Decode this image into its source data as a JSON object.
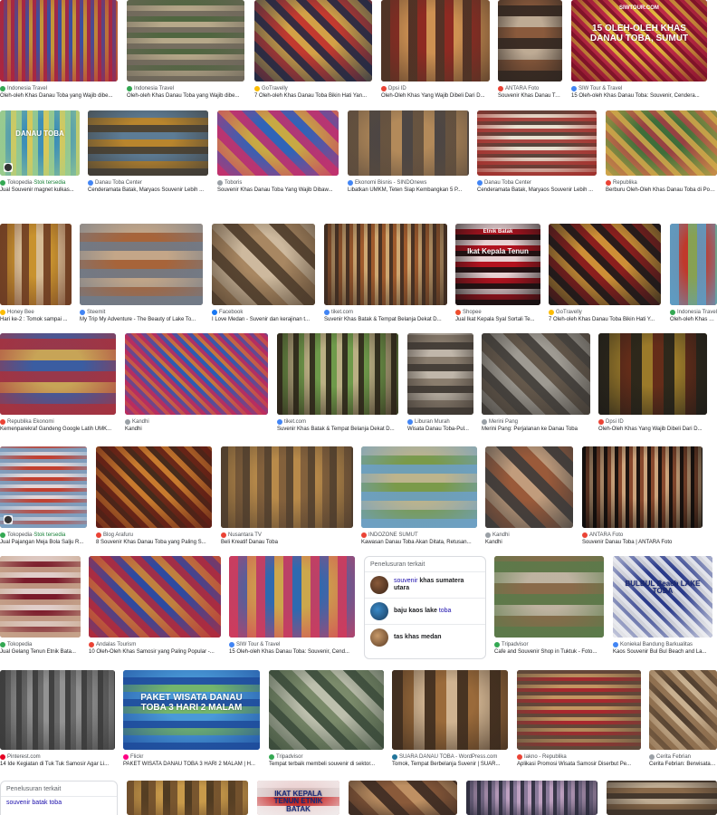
{
  "related_searches": {
    "title": "Penelusuran terkait",
    "items": [
      {
        "normal": "souvenir ",
        "bold": "khas sumatera utara"
      },
      {
        "normal": "",
        "bold": "baju kaos lake ",
        "tail": "toba"
      },
      {
        "normal": "",
        "bold": "tas khas medan",
        "tail": ""
      }
    ]
  },
  "related_searches_bottom": {
    "title": "Penelusuran terkait",
    "first": "souvenir batak toba"
  },
  "stock_label": "Stok tersedia",
  "results": [
    {
      "source": "Indonesia Travel",
      "caption": "Oleh-oleh Khas Danau Toba yang Wajib dibe...",
      "colors": [
        "#b0243a",
        "#3b4fa0",
        "#d9a227"
      ],
      "fav": "#34a853",
      "stock": false
    },
    {
      "source": "Indonesia Travel",
      "caption": "Oleh-oleh Khas Danau Toba yang Wajib dibe...",
      "colors": [
        "#6b6458",
        "#b7a98a",
        "#3e5a33"
      ],
      "fav": "#34a853",
      "stock": false
    },
    {
      "source": "GoTravelly",
      "caption": "7 Oleh-oleh Khas Danau Toba Bikin Hati Yan...",
      "colors": [
        "#1f2a44",
        "#c33a2f",
        "#d6b24a"
      ],
      "fav": "#fbbc05",
      "stock": false
    },
    {
      "source": "Dpsi ID",
      "caption": "Oleh-Oleh Khas Yang Wajib Dibeli Dari D...",
      "colors": [
        "#4b3426",
        "#8e2a22",
        "#d9a35b"
      ],
      "fav": "#ea4335",
      "stock": false
    },
    {
      "source": "ANTARA Foto",
      "caption": "Souvenir Khas Danau Toba | ANTARA Foto",
      "colors": [
        "#2e2520",
        "#8a5a3c",
        "#c7b9a4"
      ],
      "fav": "#ea4335",
      "stock": false
    },
    {
      "source": "SIW Tour & Travel",
      "caption": "15 Oleh-oleh Khas Danau Toba: Souvenir, Cendera...",
      "colors": [
        "#7a1126",
        "#c42d4a",
        "#e8d23c"
      ],
      "fav": "#4285f4",
      "stock": false,
      "overlay": "15 OLEH-OLEH KHAS DANAU TOBA, SUMUT",
      "overlay_top": "SIWTOUR.COM"
    },
    {
      "source": "Tokopedia",
      "caption": "Jual Souvenir magnet kulkas...",
      "colors": [
        "#9fcf8c",
        "#3e8fb7",
        "#f2d24a"
      ],
      "fav": "#34a853",
      "stock": true,
      "overlay": "DANAU TOBA"
    },
    {
      "source": "Danau Toba Center",
      "caption": "Cenderamata Batak, Maryaos Souvenir Lebih ...",
      "colors": [
        "#3c3a36",
        "#b9852d",
        "#4d7aa7"
      ],
      "fav": "#4285f4",
      "stock": false
    },
    {
      "source": "Toboris",
      "caption": "Souvenir Khas Danau Toba Yang Wajib Dibaw...",
      "colors": [
        "#c6306a",
        "#2f64b8",
        "#e2b530"
      ],
      "fav": "#9aa0a6",
      "stock": false
    },
    {
      "source": "Ekonomi Bisnis - SINDOnews",
      "caption": "Libatkan UMKM, Teten Siap Kembangkan 5 P...",
      "colors": [
        "#5a4a3c",
        "#b38a5a",
        "#3a3a40"
      ],
      "fav": "#4285f4",
      "stock": false
    },
    {
      "source": "Danau Toba Center",
      "caption": "Cenderamata Batak, Maryaos Souvenir Lebih ...",
      "colors": [
        "#9c2b27",
        "#e9e2d2",
        "#3b2a22"
      ],
      "fav": "#4285f4",
      "stock": false
    },
    {
      "source": "Republika",
      "caption": "Berburu Oleh-Oleh Khas Danau Toba di Pontai Lumb...",
      "colors": [
        "#d4a64a",
        "#3f6e3a",
        "#a53a45"
      ],
      "fav": "#ea4335",
      "stock": false
    },
    {
      "source": "Honey Bee",
      "caption": "Hari ke-2 : Tomok sampai ...",
      "colors": [
        "#6a3a24",
        "#c8922e",
        "#d9c3a6"
      ],
      "fav": "#fbbc05",
      "stock": false
    },
    {
      "source": "Steemit",
      "caption": "My Trip My Adventure - The Beauty of Lake To...",
      "colors": [
        "#6f7b8a",
        "#a7643a",
        "#c9b296"
      ],
      "fav": "#4285f4",
      "stock": false
    },
    {
      "source": "Facebook",
      "caption": "I Love Medan - Suvenir dan kerajinan t...",
      "colors": [
        "#4b3a2a",
        "#a88762",
        "#d4c2a8"
      ],
      "fav": "#1877f2",
      "stock": false
    },
    {
      "source": "tiket.com",
      "caption": "Suvenir Khas Batak & Tempat Belanja Dekat D...",
      "colors": [
        "#3a2b22",
        "#a05a2c",
        "#d7b57e"
      ],
      "fav": "#4285f4",
      "stock": false
    },
    {
      "source": "Shopee",
      "caption": "Jual Ikat Kepala Syal Sortali Te...",
      "colors": [
        "#111111",
        "#b3121f",
        "#f1f1f1"
      ],
      "fav": "#ee4d2d",
      "stock": false,
      "overlay": "Ikat Kepala Tenun",
      "overlay_top": "Etnik Batak"
    },
    {
      "source": "GoTravelly",
      "caption": "7 Oleh-oleh Khas Danau Toba Bikin Hati Y...",
      "colors": [
        "#1a1a1a",
        "#8b1f1d",
        "#d9a23a"
      ],
      "fav": "#fbbc05",
      "stock": false
    },
    {
      "source": "Indonesia Travel",
      "caption": "Oleh-oleh Khas Da...",
      "colors": [
        "#5aa0c9",
        "#c0392b",
        "#7db35a"
      ],
      "fav": "#34a853",
      "stock": false
    },
    {
      "source": "Republika Ekonomi",
      "caption": "Kemenparekraf Gandeng Google Latih UMK...",
      "colors": [
        "#a8313c",
        "#3b5da1",
        "#e0b14a"
      ],
      "fav": "#ea4335",
      "stock": false
    },
    {
      "source": "Kandhi",
      "caption": "Kandhi",
      "colors": [
        "#c12a5a",
        "#2e5bb0",
        "#e07b2a"
      ],
      "fav": "#9aa0a6",
      "stock": false
    },
    {
      "source": "tiket.com",
      "caption": "Suvenir Khas Batak & Tempat Belanja Dekat D...",
      "colors": [
        "#2b2118",
        "#6e9a4a",
        "#c8b48e"
      ],
      "fav": "#4285f4",
      "stock": false
    },
    {
      "source": "Liburan Murah",
      "caption": "Wisata Danau Toba-Pul...",
      "colors": [
        "#3b3530",
        "#8a7d6e",
        "#c9c0b4"
      ],
      "fav": "#4285f4",
      "stock": false
    },
    {
      "source": "Merini Pang",
      "caption": "Merini Pang: Perjalanan ke Danau Toba",
      "colors": [
        "#3a3632",
        "#9e9a92",
        "#5a4c3e"
      ],
      "fav": "#9aa0a6",
      "stock": false
    },
    {
      "source": "Dpsi ID",
      "caption": "Oleh-Oleh Khas Yang Wajib Dibeli Dari D...",
      "colors": [
        "#1b1a18",
        "#9b7a2a",
        "#5a1f16"
      ],
      "fav": "#ea4335",
      "stock": false
    },
    {
      "source": "Tokopedia",
      "caption": "Jual Pajangan Meja Bola Salju R...",
      "colors": [
        "#7aa5c8",
        "#c23e2e",
        "#e8f1f6"
      ],
      "fav": "#34a853",
      "stock": true
    },
    {
      "source": "Blog Arafuru",
      "caption": "8 Souvenir Khas Danau Toba yang Paling S...",
      "colors": [
        "#5b1a14",
        "#c77a2e",
        "#2e1d18"
      ],
      "fav": "#ea4335",
      "stock": false
    },
    {
      "source": "Nusantara TV",
      "caption": "Beli Kreatif Danau Toba",
      "colors": [
        "#4a3a2c",
        "#b88a4a",
        "#7a5a3a"
      ],
      "fav": "#ea4335",
      "stock": false
    },
    {
      "source": "INDOZONE SUMUT",
      "caption": "Kawasan Danau Toba Akan Ditata, Retusan...",
      "colors": [
        "#6da0c8",
        "#7a9a4a",
        "#c8b898"
      ],
      "fav": "#ea4335",
      "stock": false
    },
    {
      "source": "Kandhi",
      "caption": "Kandhi",
      "colors": [
        "#3a3a3a",
        "#9a5a3a",
        "#c8a888"
      ],
      "fav": "#9aa0a6",
      "stock": false
    },
    {
      "source": "ANTARA Foto",
      "caption": "Souvenir Danau Toba | ANTARA Foto",
      "colors": [
        "#0a0a0a",
        "#8a4a2e",
        "#d9b48a"
      ],
      "fav": "#ea4335",
      "stock": false
    },
    {
      "source": "Tokopedia",
      "caption": "Jual Gelang Tenun Etnik Bata...",
      "colors": [
        "#c9a88e",
        "#7a1a2a",
        "#f2ede6"
      ],
      "fav": "#34a853",
      "stock": false
    },
    {
      "source": "Andalas Tourism",
      "caption": "10 Oleh-Oleh Khas Samosir yang Paling Popular -...",
      "colors": [
        "#b32a3a",
        "#2e4aa0",
        "#d98a2e"
      ],
      "fav": "#ea4335",
      "stock": false
    },
    {
      "source": "SIW Tour & Travel",
      "caption": "15 Oleh-oleh Khas Danau Toba: Souvenir, Cend...",
      "colors": [
        "#d43a5a",
        "#2e6ab0",
        "#e8b23a"
      ],
      "fav": "#4285f4",
      "stock": false
    },
    {
      "source": "Tripadvisor",
      "caption": "Cafe and Souvenir Shop in Tuktuk - Foto...",
      "colors": [
        "#5a7a4a",
        "#8a6a4a",
        "#c8c0b0"
      ],
      "fav": "#34a853",
      "stock": false
    },
    {
      "source": "Koniekal Bandung Barkualitas",
      "caption": "Kaos Souvenir Bul Bul Beach and La...",
      "colors": [
        "#f5f5f5",
        "#2a3a8a",
        "#d8d8d8"
      ],
      "fav": "#4285f4",
      "stock": false,
      "overlay": "BULBUL Beach LAKE TOBA",
      "overlay_top": ""
    },
    {
      "source": "Pinterest.com",
      "caption": "14 Ide Kegiatan di Tuk Tuk Samosir Agar Li...",
      "colors": [
        "#3a3a3a",
        "#6a6a6a",
        "#9a9a9a"
      ],
      "fav": "#e60023",
      "stock": false
    },
    {
      "source": "Flickr",
      "caption": "PAKET WISATA DANAU TOBA 3 HARI 2 MALAM | H...",
      "colors": [
        "#1d4a9a",
        "#4a9ad8",
        "#7aba5a"
      ],
      "fav": "#ff0084",
      "stock": false,
      "overlay": "PAKET WISATA DANAU TOBA 3 HARI 2 MALAM",
      "overlay_top": ""
    },
    {
      "source": "Tripadvisor",
      "caption": "Tempat terbaik membeli souvenir di sektor...",
      "colors": [
        "#3a4a3a",
        "#7a8a6a",
        "#c8c8b8"
      ],
      "fav": "#34a853",
      "stock": false
    },
    {
      "source": "SUARA DANAU TOBA - WordPress.com",
      "caption": "Tomok, Tempat Berbelanja Suvenir | SUAR...",
      "colors": [
        "#3a2a1e",
        "#9a6a3a",
        "#d9c0a0"
      ],
      "fav": "#21759b",
      "stock": false
    },
    {
      "source": "Iakno - Republika",
      "caption": "Aplikasi Promosi Wisata Samosir Diserbut Pe...",
      "colors": [
        "#5a4a3a",
        "#a8282e",
        "#c8a86a"
      ],
      "fav": "#ea4335",
      "stock": false
    },
    {
      "source": "Cerita Febrian",
      "caption": "Cerita Febrian: Berwisata k...",
      "colors": [
        "#8a6a4a",
        "#c8b090",
        "#3a2a1e"
      ],
      "fav": "#9aa0a6",
      "stock": false
    },
    {
      "source": "",
      "caption": "",
      "colors": [
        "#6a4a2a",
        "#c89a4a",
        "#3a2a1a"
      ],
      "fav": "#9aa0a6",
      "stock": false
    },
    {
      "source": "",
      "caption": "",
      "colors": [
        "#f2f2f2",
        "#c82a2a",
        "#d8d8d8"
      ],
      "fav": "#9aa0a6",
      "stock": false,
      "overlay": "IKAT KEPALA TENUN ETNIK BATAK",
      "overlay_top": ""
    },
    {
      "source": "",
      "caption": "",
      "colors": [
        "#3a2a22",
        "#8a5a3a",
        "#c89a6a"
      ],
      "fav": "#9aa0a6",
      "stock": false
    },
    {
      "source": "",
      "caption": "",
      "colors": [
        "#2a2a3a",
        "#8a7a9a",
        "#c8a8c8"
      ],
      "fav": "#9aa0a6",
      "stock": false
    },
    {
      "source": "",
      "caption": "",
      "colors": [
        "#3a3028",
        "#8a6a4a",
        "#c8b8a0"
      ],
      "fav": "#9aa0a6",
      "stock": false
    },
    {
      "source": "",
      "caption": "",
      "colors": [
        "#4a6a8a",
        "#8aaac8",
        "#e8e8e8"
      ],
      "fav": "#9aa0a6",
      "stock": false
    }
  ]
}
